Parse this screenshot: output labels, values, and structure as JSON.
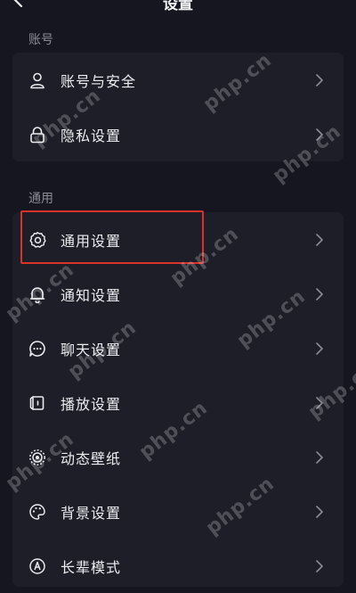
{
  "nav": {
    "title": "设置"
  },
  "sections": [
    {
      "label": "账号",
      "items": [
        {
          "label": "账号与安全",
          "icon": "person-icon"
        },
        {
          "label": "隐私设置",
          "icon": "lock-icon"
        }
      ]
    },
    {
      "label": "通用",
      "items": [
        {
          "label": "通用设置",
          "icon": "gear-icon"
        },
        {
          "label": "通知设置",
          "icon": "bell-icon"
        },
        {
          "label": "聊天设置",
          "icon": "chat-bubble-icon"
        },
        {
          "label": "播放设置",
          "icon": "play-device-icon"
        },
        {
          "label": "动态壁纸",
          "icon": "live-wallpaper-icon"
        },
        {
          "label": "背景设置",
          "icon": "palette-icon"
        },
        {
          "label": "长辈模式",
          "icon": "elder-mode-icon"
        }
      ]
    }
  ],
  "highlight_color": "#d8332b",
  "watermark": "php.cn"
}
